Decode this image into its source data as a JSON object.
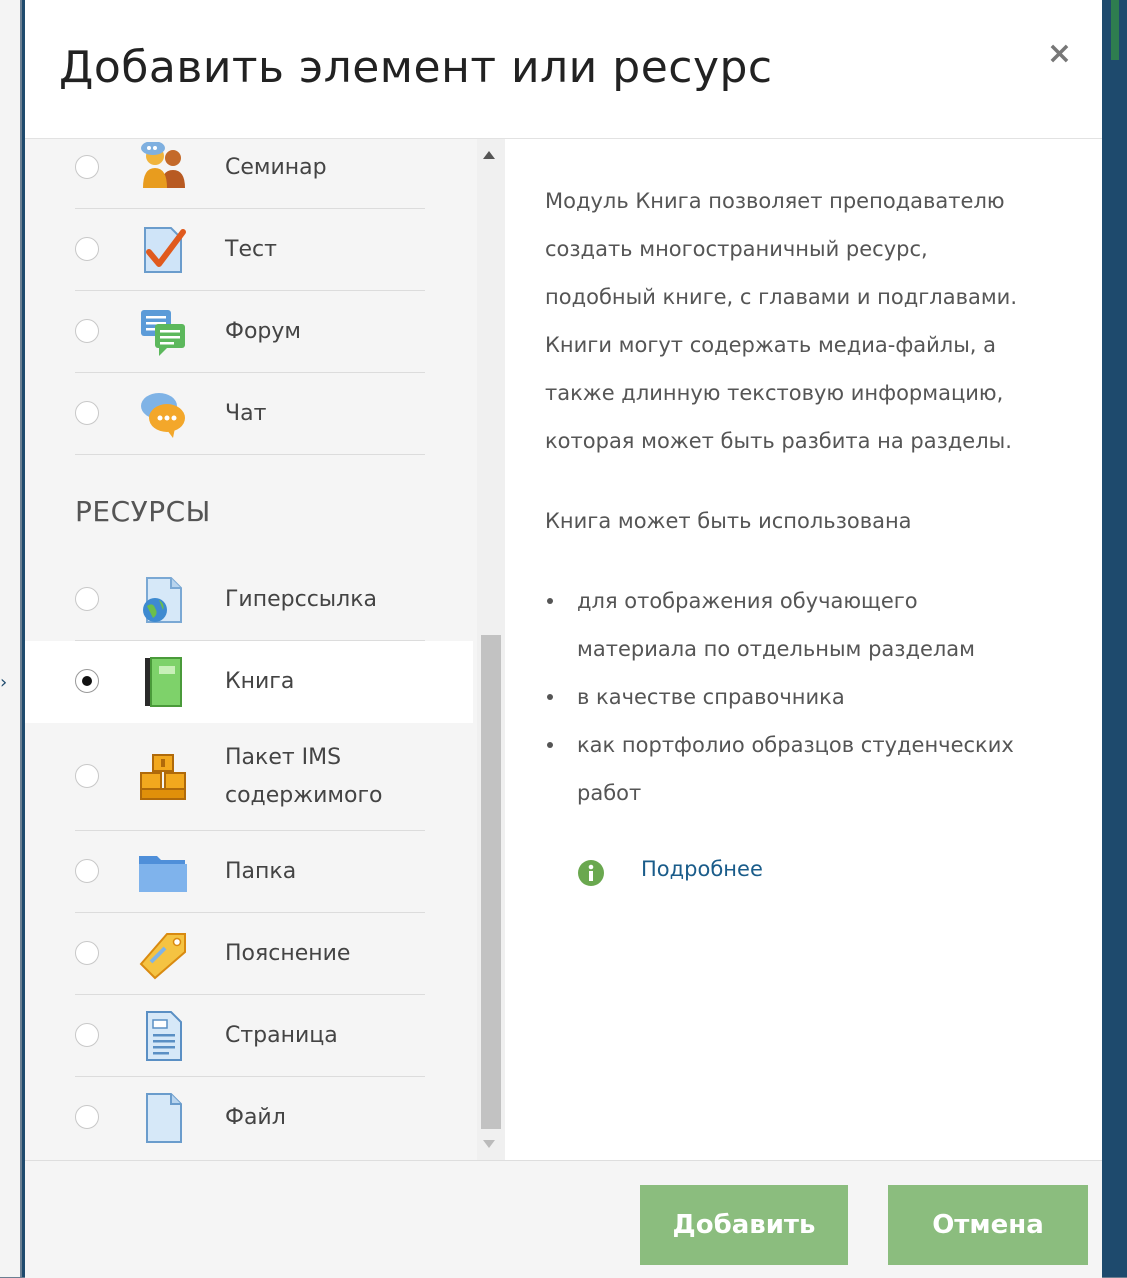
{
  "dialog": {
    "title": "Добавить элемент или ресурс",
    "close_symbol": "×"
  },
  "activities": [
    {
      "label": "Семинар",
      "icon": "workshop-icon"
    },
    {
      "label": "Тест",
      "icon": "quiz-icon"
    },
    {
      "label": "Форум",
      "icon": "forum-icon"
    },
    {
      "label": "Чат",
      "icon": "chat-icon"
    }
  ],
  "resources_heading": "РЕСУРСЫ",
  "resources": [
    {
      "label": "Гиперссылка",
      "icon": "url-globe-icon",
      "selected": false
    },
    {
      "label": "Книга",
      "icon": "book-icon",
      "selected": true
    },
    {
      "label_line1": "Пакет IMS",
      "label_line2": "содержимого",
      "icon": "ims-package-icon",
      "selected": false
    },
    {
      "label": "Папка",
      "icon": "folder-icon",
      "selected": false
    },
    {
      "label": "Пояснение",
      "icon": "label-tag-icon",
      "selected": false
    },
    {
      "label": "Страница",
      "icon": "page-icon",
      "selected": false
    },
    {
      "label": "Файл",
      "icon": "file-icon",
      "selected": false
    }
  ],
  "description": {
    "lines": [
      "Модуль Книга позволяет преподавателю",
      "создать многостраничный ресурс,",
      "подобный книге, с главами и подглавами.",
      "Книги могут содержать медиа-файлы, а",
      "также длинную текстовую информацию,",
      "которая может быть разбита на разделы."
    ],
    "usage_intro": "Книга может быть использована",
    "usage_items": [
      {
        "line1": "для отображения обучающего",
        "line2": "материала по отдельным разделам"
      },
      {
        "line1": "в качестве справочника",
        "line2": ""
      },
      {
        "line1": "как портфолио образцов студенческих",
        "line2": "работ"
      }
    ],
    "more_link": "Подробнее"
  },
  "footer": {
    "add_label": "Добавить",
    "cancel_label": "Отмена"
  },
  "colors": {
    "button_green": "#8bbd7e",
    "link_blue": "#1a5c8a",
    "frame_blue": "#1e4a6d"
  }
}
